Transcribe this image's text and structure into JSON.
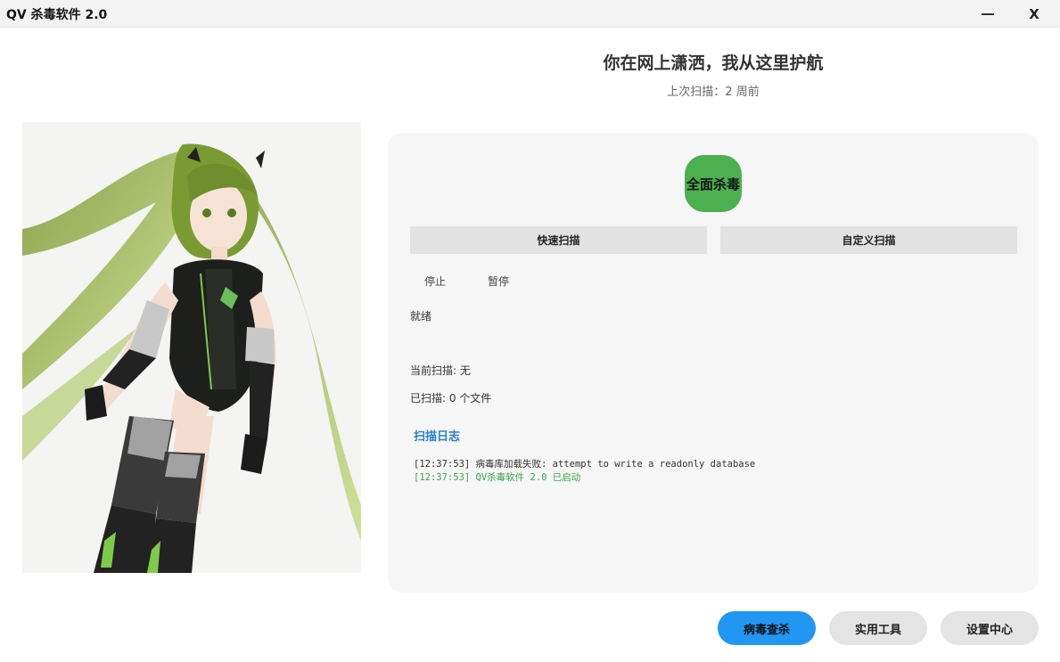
{
  "window": {
    "title": "QV 杀毒软件 2.0",
    "minimize_label": "",
    "close_label": "X"
  },
  "header": {
    "slogan": "你在网上潇洒，我从这里护航",
    "last_scan": "上次扫描：2 周前"
  },
  "scan_panel": {
    "full_scan_label": "全面杀毒",
    "quick_scan_label": "快速扫描",
    "custom_scan_label": "自定义扫描",
    "stop_label": "停止",
    "pause_label": "暂停",
    "status": "就绪",
    "current_scan": "当前扫描: 无",
    "scanned_count": "已扫描: 0 个文件",
    "log_title": "扫描日志",
    "log": [
      "[12:37:53] 病毒库加载失败: attempt to write a readonly database",
      "[12:37:53] QV杀毒软件 2.0 已启动"
    ]
  },
  "bottom_nav": {
    "virus_scan_label": "病毒查杀",
    "tools_label": "实用工具",
    "settings_label": "设置中心"
  },
  "colors": {
    "full_scan_green": "#4caf50",
    "primary_blue": "#2196f3",
    "log_title_blue": "#2a7fd4",
    "log_ok_green": "#3aa548"
  }
}
